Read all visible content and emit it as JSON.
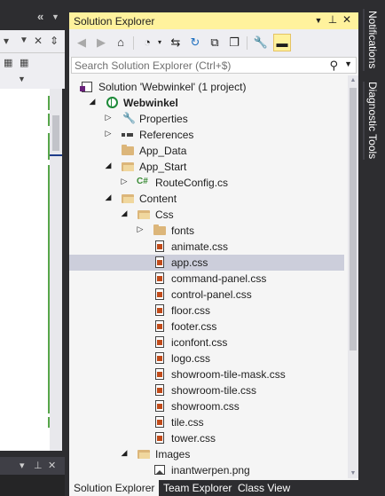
{
  "solution_explorer": {
    "title": "Solution Explorer",
    "search_placeholder": "Search Solution Explorer (Ctrl+$)",
    "tree": [
      {
        "label": "Solution 'Webwinkel' (1 project)",
        "icon": "solution-icon",
        "depth": 0,
        "expander": "none"
      },
      {
        "label": "Webwinkel",
        "icon": "web-project-icon",
        "depth": 1,
        "expander": "expanded",
        "bold": true
      },
      {
        "label": "Properties",
        "icon": "wrench-icon",
        "depth": 2,
        "expander": "collapsed"
      },
      {
        "label": "References",
        "icon": "references-icon",
        "depth": 2,
        "expander": "collapsed"
      },
      {
        "label": "App_Data",
        "icon": "folder-icon",
        "depth": 2,
        "expander": "none"
      },
      {
        "label": "App_Start",
        "icon": "folder-open-icon",
        "depth": 2,
        "expander": "expanded"
      },
      {
        "label": "RouteConfig.cs",
        "icon": "csharp-file-icon",
        "depth": 3,
        "expander": "collapsed"
      },
      {
        "label": "Content",
        "icon": "folder-open-icon",
        "depth": 2,
        "expander": "expanded"
      },
      {
        "label": "Css",
        "icon": "folder-open-icon",
        "depth": 3,
        "expander": "expanded"
      },
      {
        "label": "fonts",
        "icon": "folder-icon",
        "depth": 4,
        "expander": "collapsed"
      },
      {
        "label": "animate.css",
        "icon": "css-file-icon",
        "depth": 4,
        "expander": "none"
      },
      {
        "label": "app.css",
        "icon": "css-file-icon",
        "depth": 4,
        "expander": "none",
        "selected": true
      },
      {
        "label": "command-panel.css",
        "icon": "css-file-icon",
        "depth": 4,
        "expander": "none"
      },
      {
        "label": "control-panel.css",
        "icon": "css-file-icon",
        "depth": 4,
        "expander": "none"
      },
      {
        "label": "floor.css",
        "icon": "css-file-icon",
        "depth": 4,
        "expander": "none"
      },
      {
        "label": "footer.css",
        "icon": "css-file-icon",
        "depth": 4,
        "expander": "none"
      },
      {
        "label": "iconfont.css",
        "icon": "css-file-icon",
        "depth": 4,
        "expander": "none"
      },
      {
        "label": "logo.css",
        "icon": "css-file-icon",
        "depth": 4,
        "expander": "none"
      },
      {
        "label": "showroom-tile-mask.css",
        "icon": "css-file-icon",
        "depth": 4,
        "expander": "none"
      },
      {
        "label": "showroom-tile.css",
        "icon": "css-file-icon",
        "depth": 4,
        "expander": "none"
      },
      {
        "label": "showroom.css",
        "icon": "css-file-icon",
        "depth": 4,
        "expander": "none"
      },
      {
        "label": "tile.css",
        "icon": "css-file-icon",
        "depth": 4,
        "expander": "none"
      },
      {
        "label": "tower.css",
        "icon": "css-file-icon",
        "depth": 4,
        "expander": "none"
      },
      {
        "label": "Images",
        "icon": "folder-open-icon",
        "depth": 3,
        "expander": "expanded"
      },
      {
        "label": "inantwerpen.png",
        "icon": "png-file-icon",
        "depth": 4,
        "expander": "none"
      }
    ],
    "bottom_tabs": [
      "Solution Explorer",
      "Team Explorer",
      "Class View"
    ]
  },
  "right_tabs": [
    "Notifications",
    "Diagnostic Tools"
  ],
  "colors": {
    "title_active": "#fff29d",
    "tree_bg": "#f5f5f5",
    "selected_row": "#cccedb",
    "chrome_dark": "#2d2d30"
  }
}
